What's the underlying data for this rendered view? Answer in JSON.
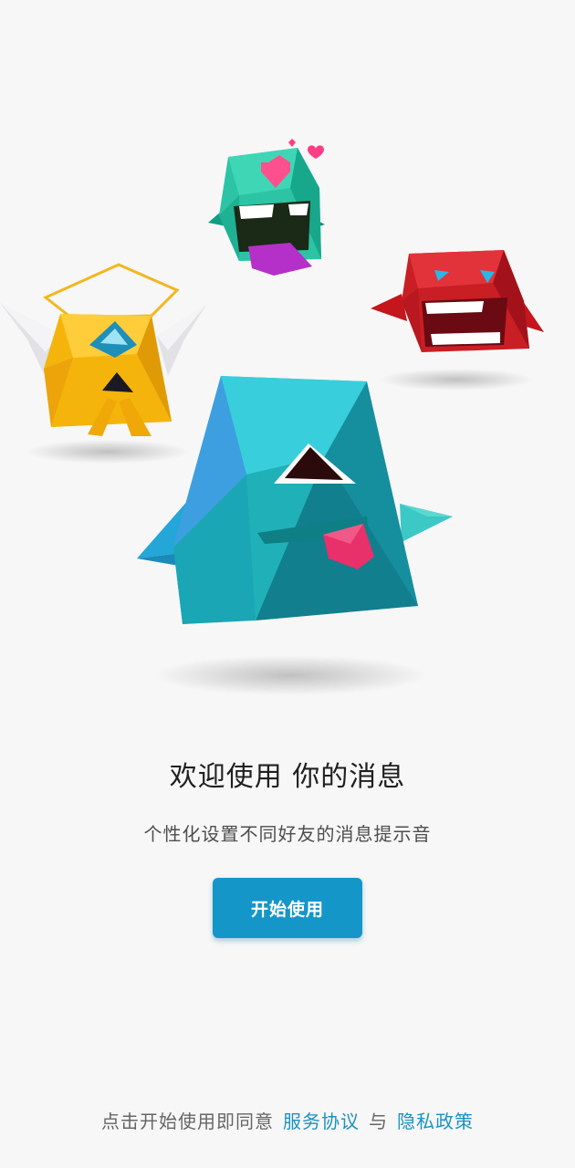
{
  "welcome": {
    "title": "欢迎使用 你的消息",
    "subtitle": "个性化设置不同好友的消息提示音"
  },
  "actions": {
    "start_label": "开始使用"
  },
  "agreement": {
    "prefix": "点击开始使用即同意",
    "terms_link": "服务协议",
    "conjunction": "与",
    "privacy_link": "隐私政策"
  },
  "colors": {
    "background": "#f7f7f7",
    "accent": "#1596c9",
    "link": "#1a92c4"
  },
  "illustration": {
    "monsters": [
      "green-love-monster",
      "red-crying-monster",
      "yellow-angel-monster",
      "teal-tongue-monster"
    ]
  }
}
